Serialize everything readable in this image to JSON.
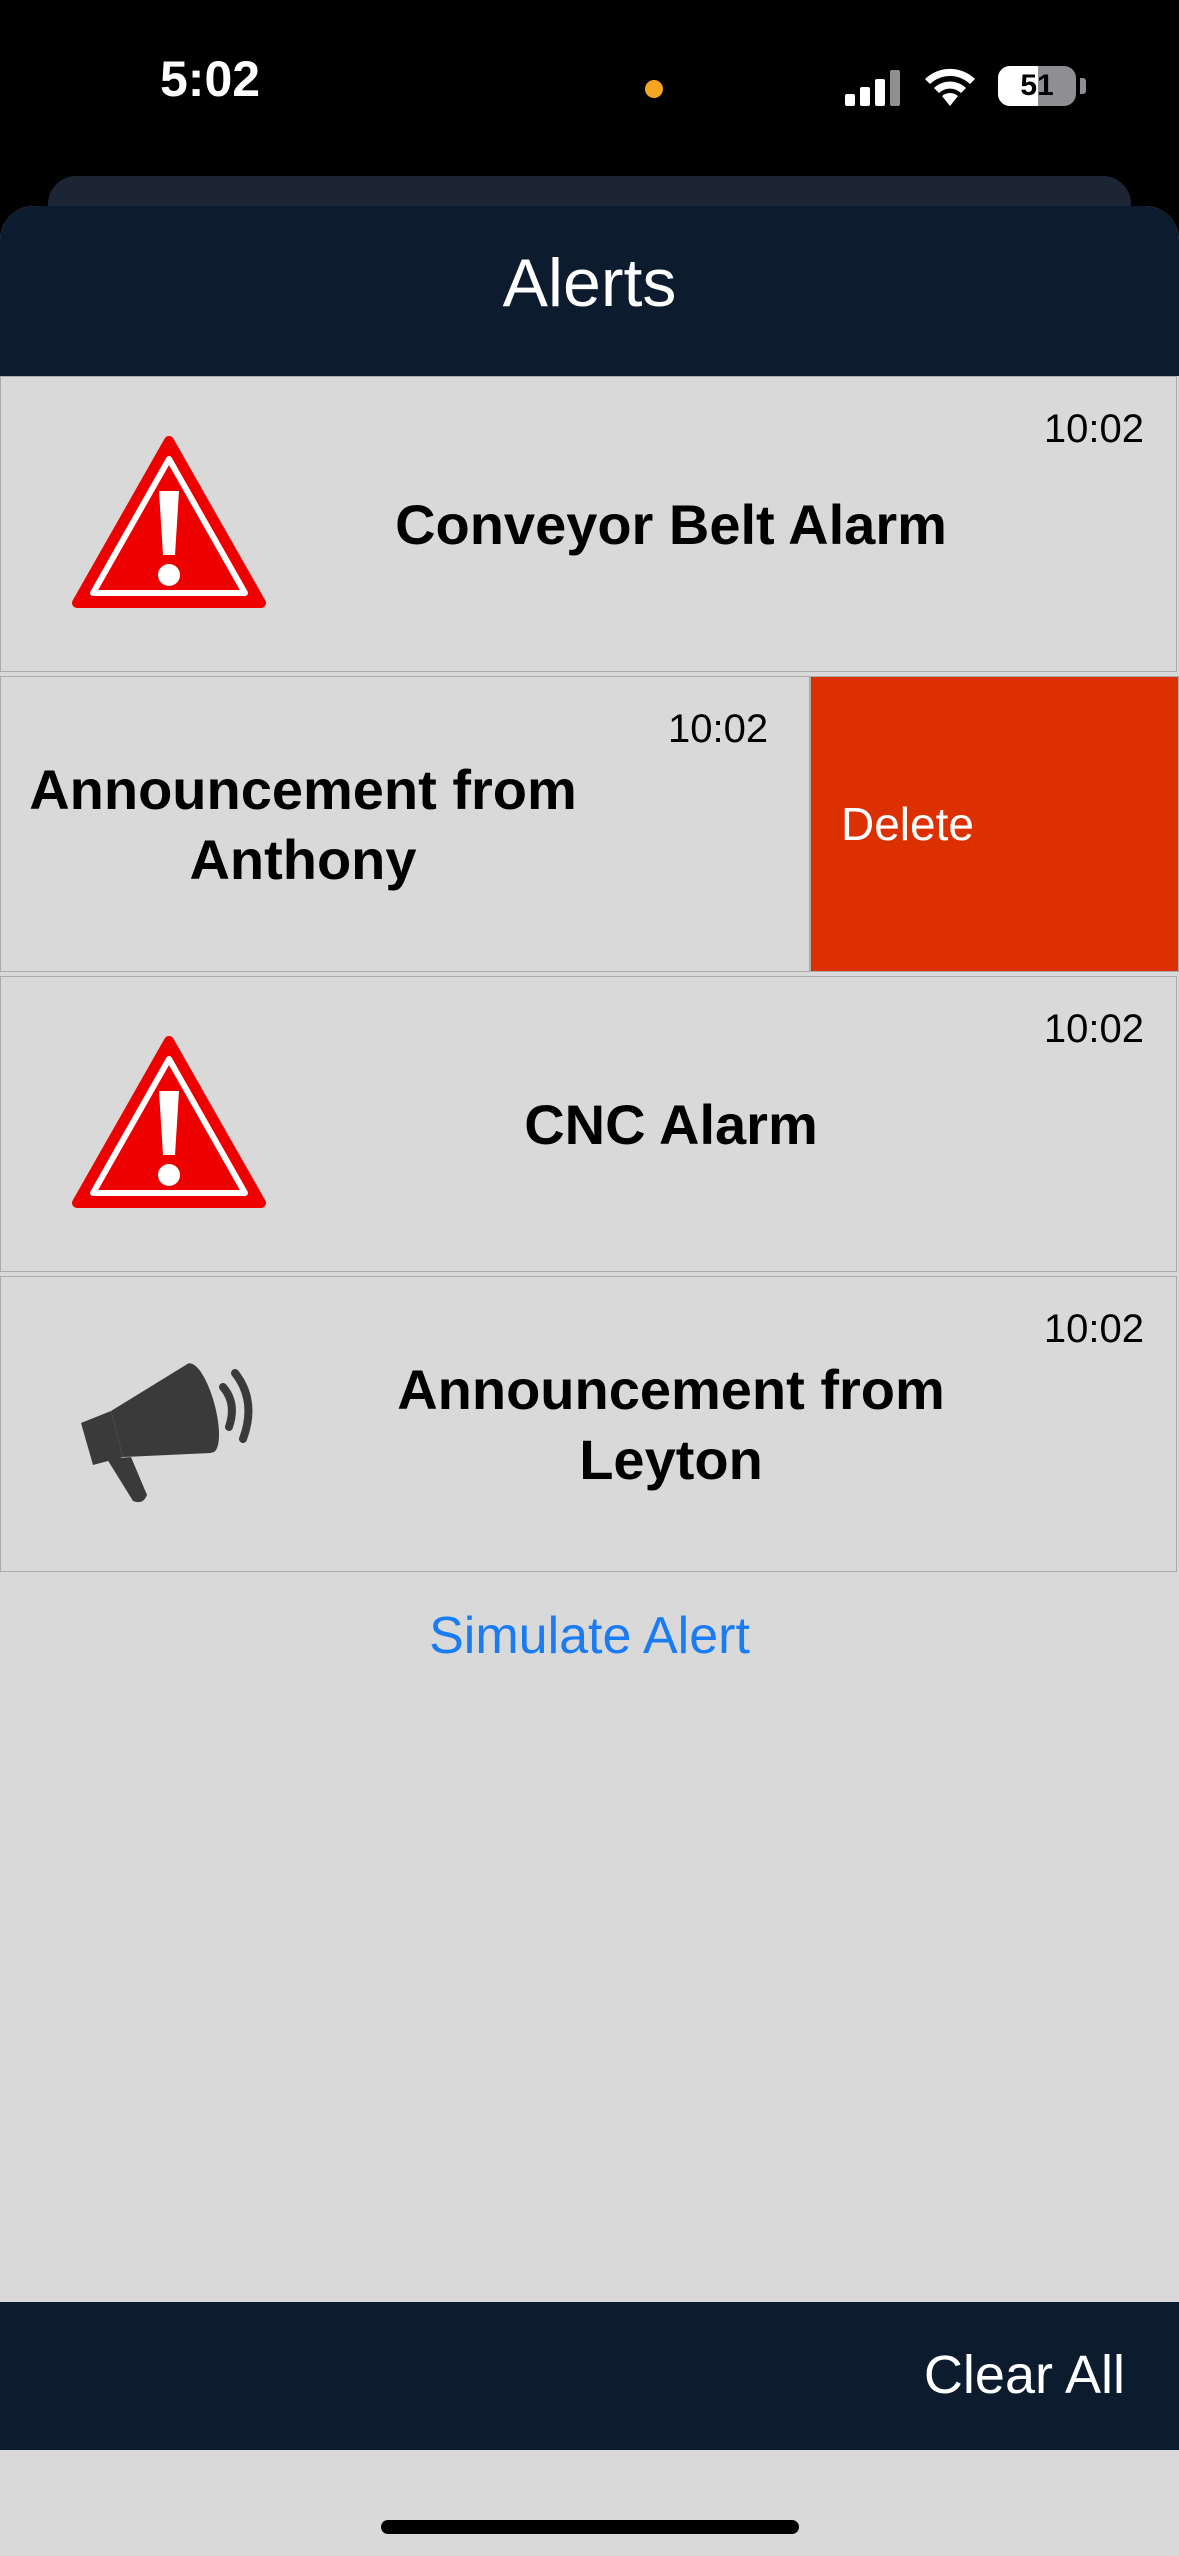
{
  "status_bar": {
    "time": "5:02",
    "battery_level": "51",
    "recording_dot_color": "#f5a623",
    "icons": [
      "signal-icon",
      "wifi-icon",
      "battery-icon"
    ]
  },
  "header": {
    "title": "Alerts"
  },
  "alerts": [
    {
      "title": "Conveyor Belt Alarm",
      "time": "10:02",
      "icon": "warning-triangle-icon"
    },
    {
      "title": "Announcement from Anthony",
      "time": "10:02",
      "icon": "megaphone-icon",
      "swiped": true
    },
    {
      "title": "CNC Alarm",
      "time": "10:02",
      "icon": "warning-triangle-icon"
    },
    {
      "title": "Announcement from Leyton",
      "time": "10:02",
      "icon": "megaphone-icon"
    }
  ],
  "swipe_action": {
    "label": "Delete",
    "color": "#dd3000"
  },
  "simulate": {
    "label": "Simulate Alert"
  },
  "footer": {
    "clear_all_label": "Clear All"
  },
  "colors": {
    "header_bg": "#0d1b2e",
    "list_bg": "#d9d9d9",
    "alarm_red": "#ee0000",
    "link_blue": "#1a7cf5"
  }
}
